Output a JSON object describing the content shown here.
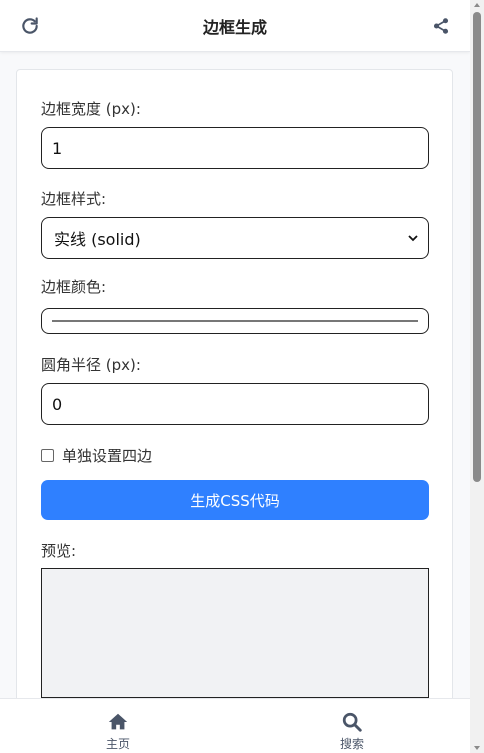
{
  "header": {
    "title": "边框生成",
    "left_icon": "refresh-icon",
    "right_icon": "share-icon"
  },
  "form": {
    "border_width_label": "边框宽度 (px):",
    "border_width_value": "1",
    "border_style_label": "边框样式:",
    "border_style_value": "实线 (solid)",
    "border_color_label": "边框颜色:",
    "radius_label": "圆角半径 (px):",
    "radius_value": "0",
    "separate_sides_label": "单独设置四边",
    "separate_sides_checked": false,
    "generate_button": "生成CSS代码",
    "preview_label": "预览:"
  },
  "bottom_nav": {
    "items": [
      {
        "label": "主页",
        "icon": "home-icon"
      },
      {
        "label": "搜索",
        "icon": "search-icon"
      }
    ]
  },
  "colors": {
    "accent": "#2f80ff",
    "nav_icon": "#4a5568",
    "preview_bg": "#f1f2f4"
  }
}
